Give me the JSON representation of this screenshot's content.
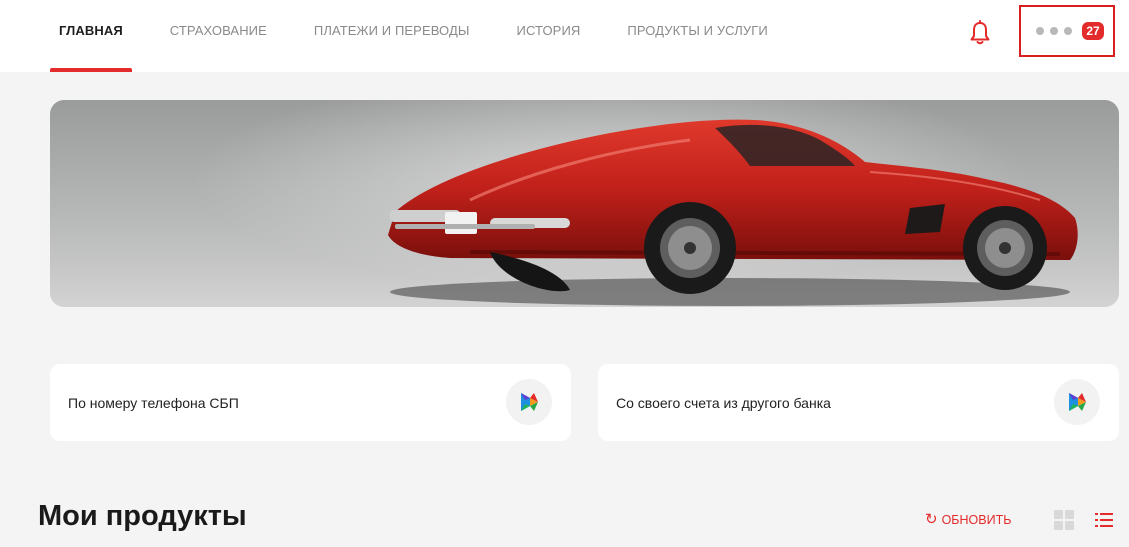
{
  "nav": {
    "items": [
      {
        "label": "ГЛАВНАЯ",
        "active": true
      },
      {
        "label": "СТРАХОВАНИЕ"
      },
      {
        "label": "ПЛАТЕЖИ И ПЕРЕВОДЫ"
      },
      {
        "label": "ИСТОРИЯ"
      },
      {
        "label": "ПРОДУКТЫ И УСЛУГИ"
      }
    ]
  },
  "header": {
    "bell_icon": "bell-icon",
    "more_icon": "more-dots-icon",
    "notifications_count": "27"
  },
  "banner": {
    "image": "red-sports-car"
  },
  "transfers": {
    "cards": [
      {
        "label": "По номеру телефона СБП",
        "icon": "sbp-icon"
      },
      {
        "label": "Со своего счета из другого банка",
        "icon": "sbp-icon"
      }
    ]
  },
  "products": {
    "title": "Мои продукты",
    "refresh_label": "ОБНОВИТЬ",
    "view_grid_icon": "grid-view-icon",
    "view_list_icon": "list-view-icon"
  },
  "colors": {
    "accent": "#e32b2b",
    "car": "#c0201a",
    "background": "#f4f4f4"
  }
}
